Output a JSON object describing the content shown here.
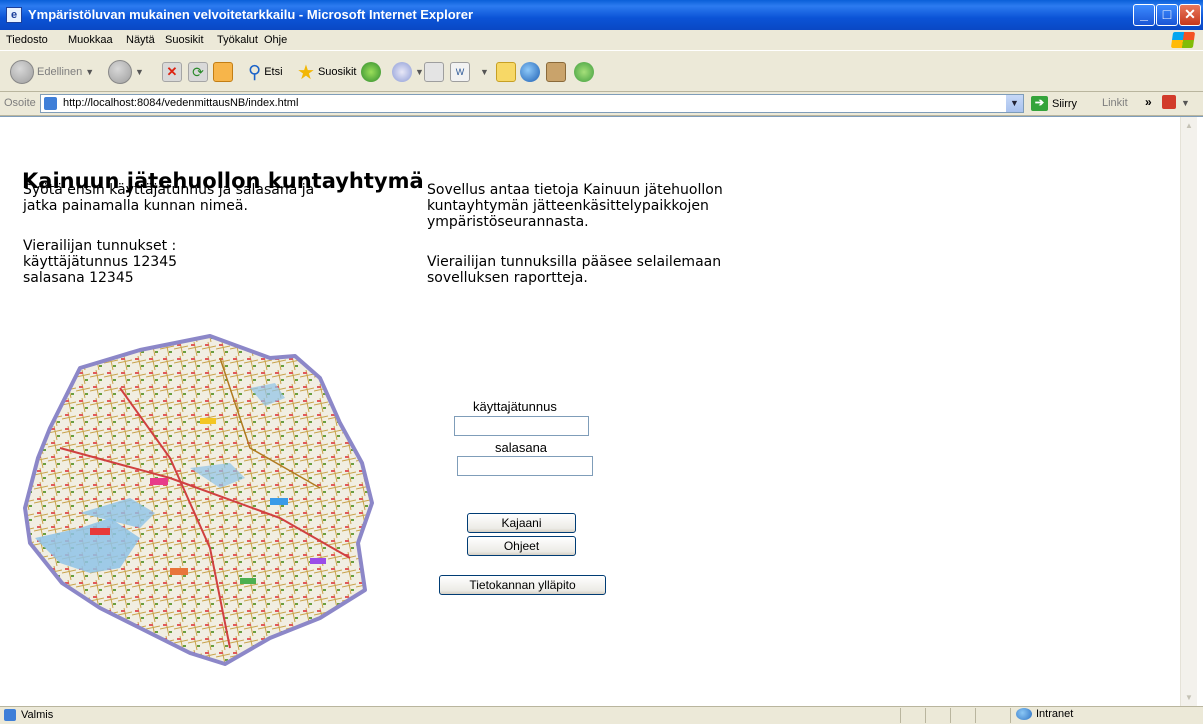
{
  "window": {
    "title": "Ympäristöluvan mukainen velvoitetarkkailu - Microsoft Internet Explorer"
  },
  "menu": {
    "items": [
      "Tiedosto",
      "Muokkaa",
      "Näytä",
      "Suosikit",
      "Työkalut",
      "Ohje"
    ]
  },
  "toolbar": {
    "back_label": "Edellinen",
    "search_label": "Etsi",
    "favorites_label": "Suosikit"
  },
  "address": {
    "label": "Osoite",
    "url": "http://localhost:8084/vedenmittausNB/index.html",
    "go_label": "Siirry",
    "links_label": "Linkit"
  },
  "page": {
    "heading": "Kainuun jätehuollon kuntayhtymä",
    "left_intro": [
      "Syötä ensin käyttäjätunnus ja salasana ja",
      "jatka painamalla kunnan nimeä."
    ],
    "visitor_lines": [
      "Vierailijan tunnukset :",
      "käyttäjätunnus 12345",
      "salasana 12345"
    ],
    "right_intro": [
      "Sovellus antaa tietoja Kainuun jätehuollon",
      "kuntayhtymän jätteenkäsittelypaikkojen",
      "ympäristöseurannasta."
    ],
    "right_visitor": [
      "Vierailijan tunnuksilla pääsee selailemaan",
      "sovelluksen raportteja."
    ]
  },
  "form": {
    "username_label": "käyttajätunnus",
    "password_label": "salasana",
    "username_value": "",
    "password_value": "",
    "buttons": {
      "kajaani": "Kajaani",
      "help": "Ohjeet",
      "admin": "Tietokannan ylläpito"
    }
  },
  "status": {
    "text": "Valmis",
    "zone": "Intranet"
  }
}
